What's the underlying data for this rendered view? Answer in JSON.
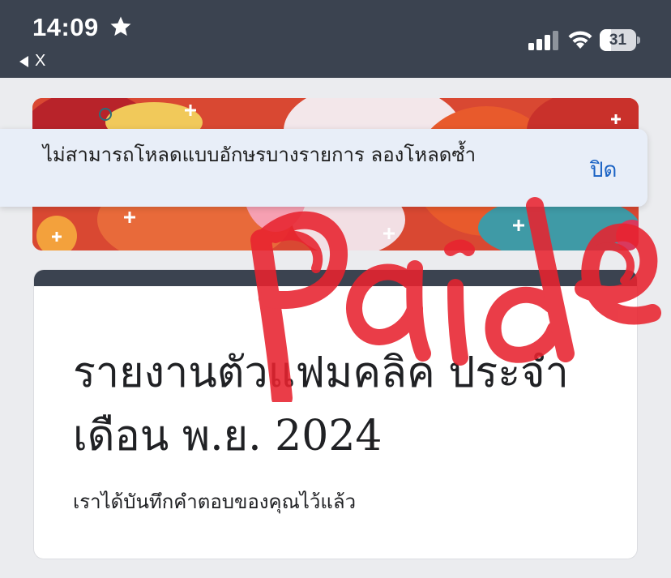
{
  "status_bar": {
    "time": "14:09",
    "back_label": "X",
    "battery_percent": "31",
    "battery_level": 0.31,
    "icons": [
      "star-icon",
      "back-arrow-icon",
      "cellular-signal-icon",
      "wifi-icon",
      "battery-icon"
    ]
  },
  "toast": {
    "message": "ไม่สามารถโหลดแบบอักษรบางรายการ ลองโหลดซ้ำ",
    "action_label": "ปิด"
  },
  "form": {
    "title": "รายงานตัวแฟมคลิค ประจำเดือน พ.ย. 2024",
    "confirmation": "เราได้บันทึกคำตอบของคุณไว้แล้ว",
    "accent_color": "#3b4350"
  },
  "overlay": {
    "handwriting": "Paid",
    "color": "#e8232f"
  }
}
